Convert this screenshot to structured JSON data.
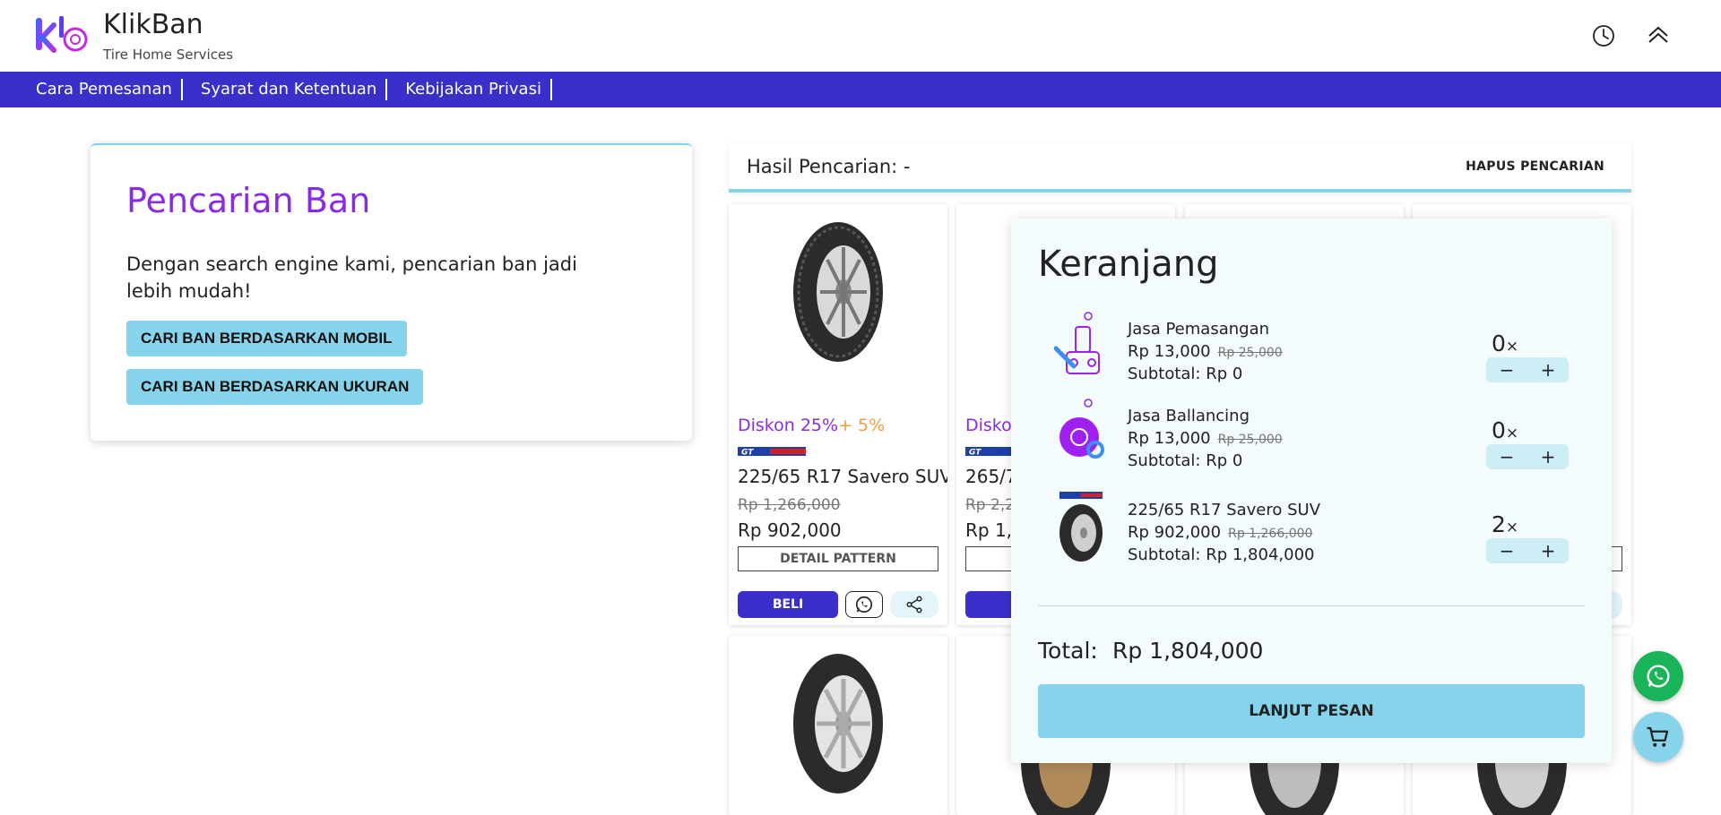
{
  "header": {
    "brand_title": "KlikBan",
    "brand_subtitle": "Tire Home Services",
    "history_icon": "clock-icon",
    "scroll_up_icon": "chevron-up-icon"
  },
  "nav": {
    "items": [
      "Cara Pemesanan",
      "Syarat dan Ketentuan",
      "Kebijakan Privasi"
    ]
  },
  "search": {
    "title": "Pencarian Ban",
    "description": "Dengan search engine kami, pencarian ban jadi lebih mudah!",
    "by_car_label": "CARI BAN BERDASARKAN MOBIL",
    "by_size_label": "CARI BAN BERDASARKAN UKURAN"
  },
  "results": {
    "label": "Hasil Pencarian: -",
    "clear_label": "HAPUS PENCARIAN",
    "products": [
      {
        "discount_main": "Diskon 25%",
        "discount_extra": "+ 5%",
        "name": "225/65 R17 Savero SUV",
        "old_price": "Rp 1,266,000",
        "price": "Rp 902,000",
        "detail_label": "DETAIL PATTERN",
        "buy_label": "BELI"
      },
      {
        "discount_main": "Disko",
        "name": "265/7",
        "old_price": "Rp 2,2",
        "price": "Rp 1,5",
        "buy_label": "B"
      }
    ]
  },
  "cart": {
    "title": "Keranjang",
    "items": [
      {
        "name": "Jasa Pemasangan",
        "price": "Rp 13,000",
        "old_price": "Rp 25,000",
        "subtotal": "Subtotal: Rp 0",
        "qty": "0",
        "qty_suffix": "×"
      },
      {
        "name": "Jasa Ballancing",
        "price": "Rp 13,000",
        "old_price": "Rp 25,000",
        "subtotal": "Subtotal: Rp 0",
        "qty": "0",
        "qty_suffix": "×"
      },
      {
        "name": "225/65 R17 Savero SUV",
        "price": "Rp 902,000",
        "old_price": "Rp 1,266,000",
        "subtotal": "Subtotal: Rp 1,804,000",
        "qty": "2",
        "qty_suffix": "×"
      }
    ],
    "minus": "−",
    "plus": "+",
    "total_label": "Total:",
    "total_value": "Rp 1,804,000",
    "checkout_label": "LANJUT PESAN"
  },
  "colors": {
    "accent": "#3a2fc8",
    "light_blue": "#86d3ec",
    "purple": "#8a2be2",
    "orange": "#f39c3d",
    "whatsapp": "#19b45a"
  }
}
